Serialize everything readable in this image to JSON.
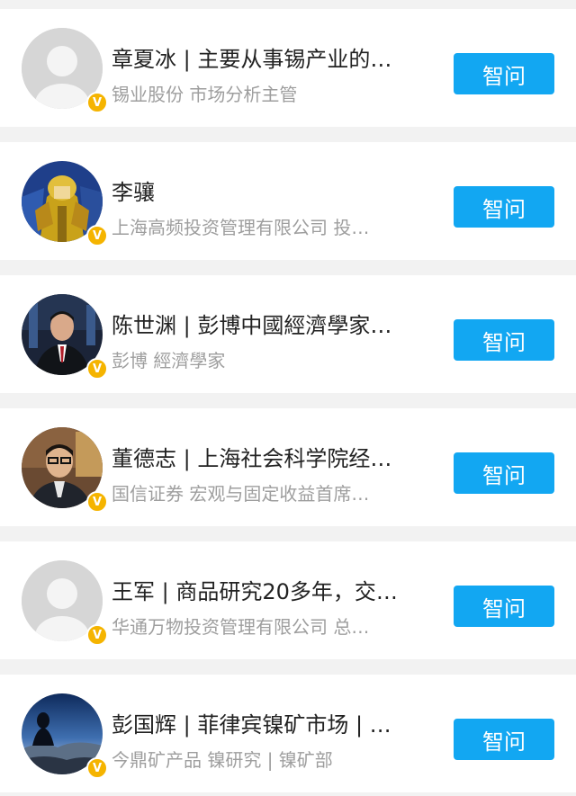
{
  "experts": [
    {
      "name": "章夏冰 | 主要从事锡产业的…",
      "subtitle": "锡业股份   市场分析主管",
      "avatar_icon": "default-avatar",
      "button_label": "智问",
      "badge": "V"
    },
    {
      "name": "李骧",
      "subtitle": "上海高频投资管理有限公司   投…",
      "avatar_icon": "anime-figure-avatar",
      "button_label": "智问",
      "badge": "V"
    },
    {
      "name": "陈世渊 | 彭博中國經濟學家…",
      "subtitle": "彭博   經濟學家",
      "avatar_icon": "man-in-suit-avatar",
      "button_label": "智问",
      "badge": "V"
    },
    {
      "name": "董德志 | 上海社会科学院经…",
      "subtitle": "国信证券   宏观与固定收益首席…",
      "avatar_icon": "man-with-glasses-avatar",
      "button_label": "智问",
      "badge": "V"
    },
    {
      "name": "王军 | 商品研究20多年，交…",
      "subtitle": "华通万物投资管理有限公司   总…",
      "avatar_icon": "default-avatar",
      "button_label": "智问",
      "badge": "V"
    },
    {
      "name": "彭国辉 | 菲律宾镍矿市场 | …",
      "subtitle": "今鼎矿产品   镍研究 | 镍矿部",
      "avatar_icon": "landscape-avatar",
      "button_label": "智问",
      "badge": "V"
    }
  ]
}
